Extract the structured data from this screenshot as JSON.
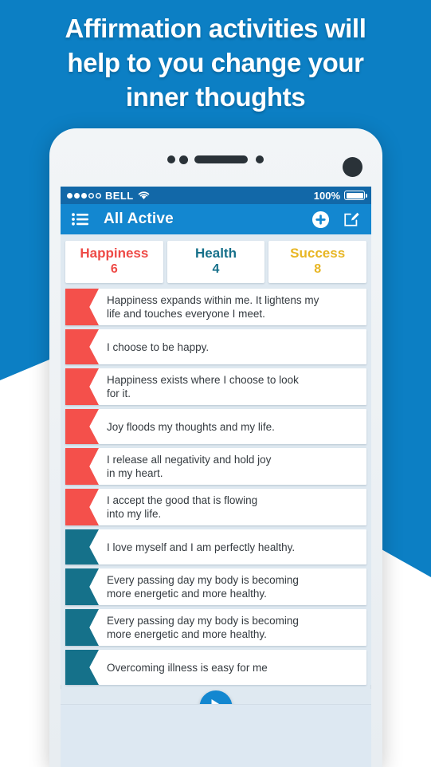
{
  "promo": {
    "headline_lines": [
      "Affirmation activities will",
      "help to you change your",
      "inner thoughts"
    ],
    "background_color": "#0c7fc4",
    "headline_color": "#ffffff"
  },
  "phone": {
    "hardware": {
      "speaker_label": "earpiece-speaker",
      "front_camera_label": "front-camera"
    }
  },
  "status_bar": {
    "signal_strength": "3 of 5",
    "carrier": "BELL",
    "wifi": "wifi-icon",
    "battery_percent": "100%",
    "battery_level": 100,
    "background_color": "#1268a8"
  },
  "nav_bar": {
    "menu_icon": "list-menu-icon",
    "title": "All Active",
    "add_icon": "plus-circle-icon",
    "compose_icon": "compose-edit-icon",
    "background_color": "#1387d0"
  },
  "tabs": [
    {
      "label": "Happiness",
      "count": "6",
      "color": "#EE4B47"
    },
    {
      "label": "Health",
      "count": "4",
      "color": "#16708A"
    },
    {
      "label": "Success",
      "count": "8",
      "color": "#E8B624"
    }
  ],
  "affirmations": [
    {
      "category": "Happiness",
      "color": "#F4504B",
      "lines": [
        "Happiness expands within me. It lightens my",
        "life and touches everyone I meet."
      ]
    },
    {
      "category": "Happiness",
      "color": "#F4504B",
      "lines": [
        "I choose to be happy."
      ]
    },
    {
      "category": "Happiness",
      "color": "#F4504B",
      "lines": [
        "Happiness exists where I choose to look",
        "for it."
      ]
    },
    {
      "category": "Happiness",
      "color": "#F4504B",
      "lines": [
        "Joy floods my thoughts and my life."
      ]
    },
    {
      "category": "Happiness",
      "color": "#F4504B",
      "lines": [
        "I release all negativity and hold joy",
        "in my heart."
      ]
    },
    {
      "category": "Happiness",
      "color": "#F4504B",
      "lines": [
        "I accept the good that is flowing",
        "into my life."
      ]
    },
    {
      "category": "Health",
      "color": "#15718A",
      "lines": [
        "I love myself and I am perfectly healthy."
      ]
    },
    {
      "category": "Health",
      "color": "#15718A",
      "lines": [
        "Every passing day my body is becoming",
        "more energetic and more healthy."
      ]
    },
    {
      "category": "Health",
      "color": "#15718A",
      "lines": [
        "Every passing day my body is becoming",
        "more energetic and more healthy."
      ]
    },
    {
      "category": "Health",
      "color": "#15718A",
      "lines": [
        "Overcoming illness is easy for me"
      ]
    }
  ],
  "player": {
    "play_icon": "play-triangle-icon",
    "button_color": "#1387d0"
  }
}
